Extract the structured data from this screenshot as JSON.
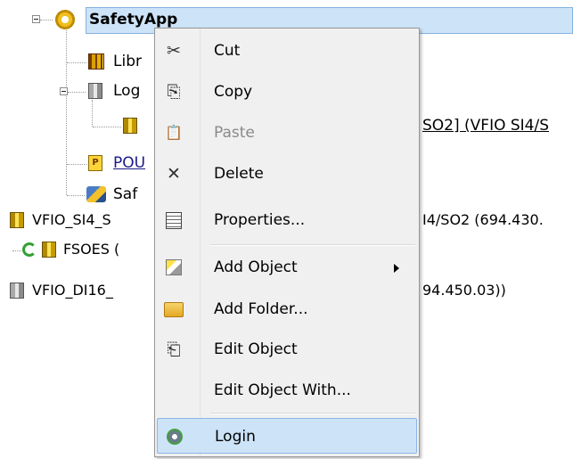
{
  "tree": {
    "root": {
      "label": "SafetyApp",
      "icon": "gear-icon"
    },
    "children": [
      {
        "label": "Libr",
        "icon": "library-icon"
      },
      {
        "label": "Log",
        "icon": "logical-device-icon"
      },
      {
        "label": "SO2]  (VFIO SI4/S",
        "icon": "device-icon"
      },
      {
        "label": "POU",
        "icon": "pou-icon"
      },
      {
        "label": "Saf",
        "icon": "safety-icon"
      }
    ],
    "devices": [
      {
        "left": "VFIO_SI4_S",
        "right": "I4/SO2 (694.430.",
        "icon": "device-icon"
      },
      {
        "left": "FSOES (",
        "right": "",
        "icon": "device-icon"
      },
      {
        "left": "VFIO_DI16_",
        "right": "94.450.03))",
        "icon": "device-icon"
      }
    ]
  },
  "menu": {
    "items": [
      {
        "label": "Cut",
        "icon": "scissors-icon",
        "glyph": "✂",
        "enabled": true
      },
      {
        "label": "Copy",
        "icon": "copy-icon",
        "glyph": "⎘",
        "enabled": true
      },
      {
        "label": "Paste",
        "icon": "paste-icon",
        "glyph": "📋",
        "enabled": false
      },
      {
        "label": "Delete",
        "icon": "delete-icon",
        "glyph": "✕",
        "enabled": true
      },
      {
        "label": "Properties...",
        "icon": "properties-icon",
        "enabled": true
      },
      {
        "label": "Add Object",
        "icon": "add-object-icon",
        "enabled": true,
        "submenu": true
      },
      {
        "label": "Add Folder...",
        "icon": "folder-icon",
        "enabled": true
      },
      {
        "label": "Edit Object",
        "icon": "edit-object-icon",
        "glyph": "⎗",
        "enabled": true
      },
      {
        "label": "Edit Object With...",
        "icon": "",
        "enabled": true
      },
      {
        "label": "Login",
        "icon": "login-icon",
        "enabled": true,
        "highlighted": true
      }
    ]
  },
  "colors": {
    "highlight_bg": "#cde3f7",
    "highlight_border": "#84b2e0",
    "menu_bg": "#f0f0f0"
  }
}
